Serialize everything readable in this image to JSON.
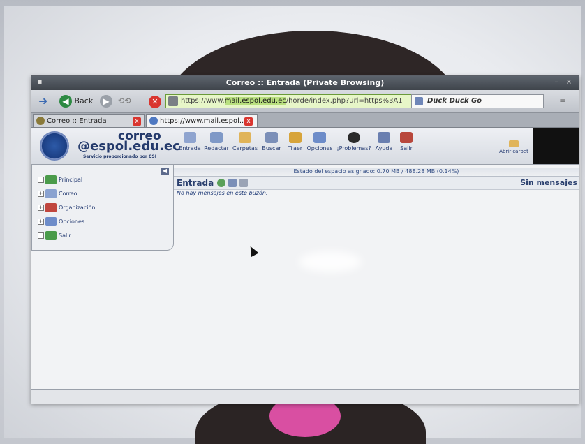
{
  "window": {
    "title": "Correo :: Entrada (Private Browsing)"
  },
  "navbar": {
    "back_label": "Back",
    "url": {
      "scheme": "https://www.",
      "host": "mail.espol.edu.ec",
      "path": "/horde/index.php?url=https%3A1"
    },
    "search_placeholder": "Duck Duck Go"
  },
  "tabs": [
    {
      "label": "Correo :: Entrada"
    },
    {
      "label": "https://www.mail.espol..."
    }
  ],
  "logo": {
    "title": "correo",
    "domain": "@espol.edu.ec",
    "subtitle": "Servicio proporcionado por CSI"
  },
  "toolbar": [
    {
      "label": "Entrada",
      "icon": "inbox-icon",
      "color": "#8fa4cf"
    },
    {
      "label": "Redactar",
      "icon": "compose-icon",
      "color": "#7f99c7"
    },
    {
      "label": "Carpetas",
      "icon": "folders-icon",
      "color": "#e0b45a"
    },
    {
      "label": "Buscar",
      "icon": "search-icon",
      "color": "#7b8fb8"
    },
    {
      "label": "Traer",
      "icon": "fetch-icon",
      "color": "#d7a43b"
    },
    {
      "label": "Opciones",
      "icon": "options-icon",
      "color": "#6d8cc9"
    },
    {
      "label": "¡Problemas?",
      "icon": "bomb-icon",
      "color": "#2b2b2b"
    },
    {
      "label": "Ayuda",
      "icon": "help-book-icon",
      "color": "#6a7fb0"
    },
    {
      "label": "Salir",
      "icon": "exit-icon",
      "color": "#b8473c"
    }
  ],
  "toolbar_right_label": "Abrir carpet",
  "sidebar": {
    "items": [
      {
        "label": "Principal",
        "icon": "home-icon",
        "color": "#4a9b4a"
      },
      {
        "label": "Correo",
        "icon": "mail-icon",
        "color": "#8aa2d0"
      },
      {
        "label": "Organización",
        "icon": "organizer-icon",
        "color": "#c0463e"
      },
      {
        "label": "Opciones",
        "icon": "options-icon",
        "color": "#6d8cc9"
      },
      {
        "label": "Salir",
        "icon": "exit-icon",
        "color": "#4a9b4a"
      }
    ]
  },
  "main": {
    "quota": "Estado del espacio asignado: 0.70 MB / 488.28 MB (0.14%)",
    "mailbox_title": "Entrada",
    "message_count": "Sin mensajes",
    "empty_notice": "No hay mensajes en este buzón."
  }
}
